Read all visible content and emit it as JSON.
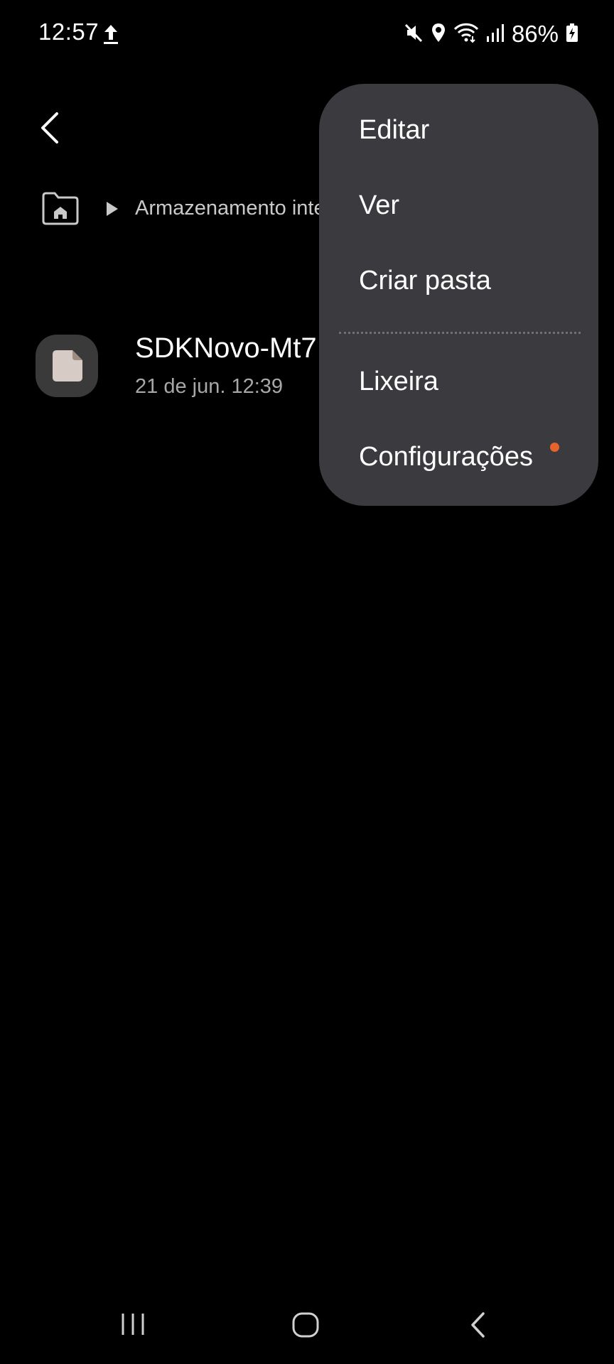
{
  "status_bar": {
    "time": "12:57",
    "battery": "86%",
    "icons": [
      "upload-icon",
      "mute-icon",
      "location-icon",
      "wifi-icon",
      "signal-icon",
      "battery-charging-icon"
    ]
  },
  "breadcrumb": {
    "label": "Armazenamento interno"
  },
  "file": {
    "name": "SDKNovo-Mt7",
    "date": "21 de jun. 12:39"
  },
  "menu": {
    "items": [
      "Editar",
      "Ver",
      "Criar pasta",
      "Lixeira",
      "Configurações"
    ],
    "new_indicator_color": "#e8632b"
  },
  "colors": {
    "background": "#000000",
    "menu_background": "#3b3a3e",
    "accent_dot": "#e8632b"
  }
}
